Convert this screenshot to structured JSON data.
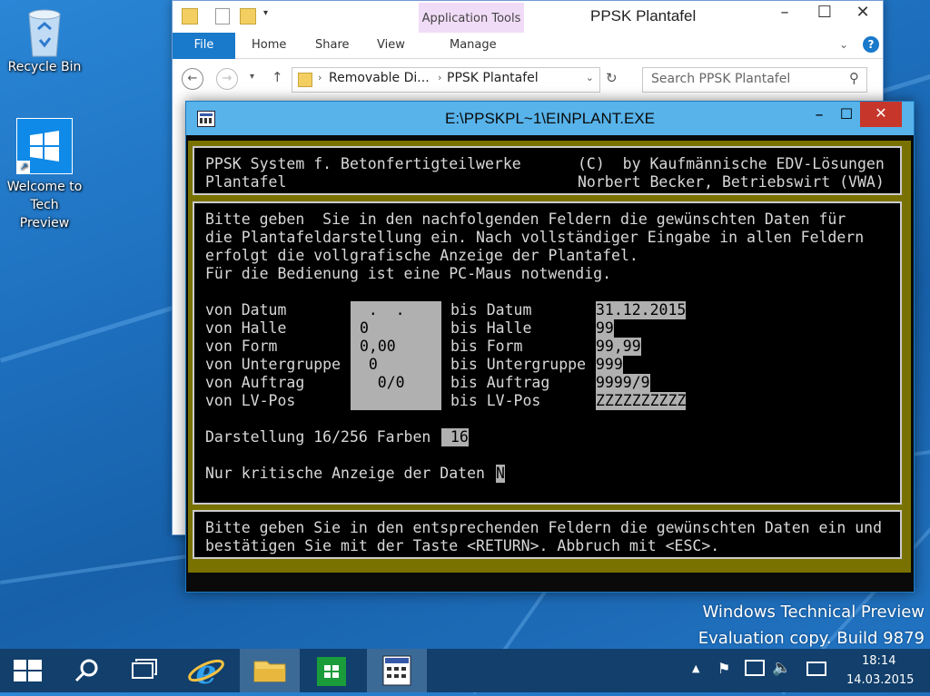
{
  "desktop": {
    "icons": [
      {
        "label": "Recycle Bin"
      },
      {
        "label": "Welcome to Tech Preview"
      }
    ],
    "watermark": {
      "line1": "Windows Technical Preview",
      "line2": "Evaluation copy. Build 9879"
    }
  },
  "explorer": {
    "title": "PPSK Plantafel",
    "context_tab": "Application Tools",
    "tabs": [
      "File",
      "Home",
      "Share",
      "View",
      "Manage"
    ],
    "breadcrumb": [
      "Removable Di...",
      "PPSK Plantafel"
    ],
    "search_placeholder": "Search PPSK Plantafel"
  },
  "dos": {
    "title": "E:\\PPSKPL~1\\EINPLANT.EXE",
    "header": {
      "line1_left": "PPSK System f. Betonfertigteilwerke",
      "line1_right": "(C)  by Kaufmännische EDV-Lösungen",
      "line2_left": "Plantafel",
      "line2_right": "Norbert Becker, Betriebswirt (VWA)"
    },
    "intro": [
      "Bitte geben  Sie in den nachfolgenden Feldern die gewünschten Daten für",
      "die Plantafeldarstellung ein. Nach vollständiger Eingabe in allen Feldern",
      "erfolgt die vollgrafische Anzeige der Plantafel.",
      "Für die Bedienung ist eine PC-Maus notwendig."
    ],
    "rows": [
      {
        "from_label": "von Datum",
        "from_value": "  .  .",
        "to_label": "bis Datum",
        "to_value": "31.12.2015"
      },
      {
        "from_label": "von Halle",
        "from_value": "0",
        "to_label": "bis Halle",
        "to_value": "99"
      },
      {
        "from_label": "von Form",
        "from_value": "0,00",
        "to_label": "bis Form",
        "to_value": "99,99"
      },
      {
        "from_label": "von Untergruppe",
        "from_value": " 0",
        "to_label": "bis Untergruppe",
        "to_value": "999"
      },
      {
        "from_label": "von Auftrag",
        "from_value": "   0/0",
        "to_label": "bis Auftrag",
        "to_value": "9999/9"
      },
      {
        "from_label": "von LV-Pos",
        "from_value": "",
        "to_label": "bis LV-Pos",
        "to_value": "ZZZZZZZZZZ"
      }
    ],
    "colors_label": "Darstellung 16/256 Farben",
    "colors_value": " 16",
    "critical_label": "Nur kritische Anzeige der Daten",
    "critical_value": "N",
    "footer": [
      "Bitte geben Sie in den entsprechenden Feldern die gewünschten Daten ein und",
      "bestätigen Sie mit der Taste <RETURN>. Abbruch mit <ESC>."
    ]
  },
  "taskbar": {
    "time": "18:14",
    "date": "14.03.2015"
  }
}
